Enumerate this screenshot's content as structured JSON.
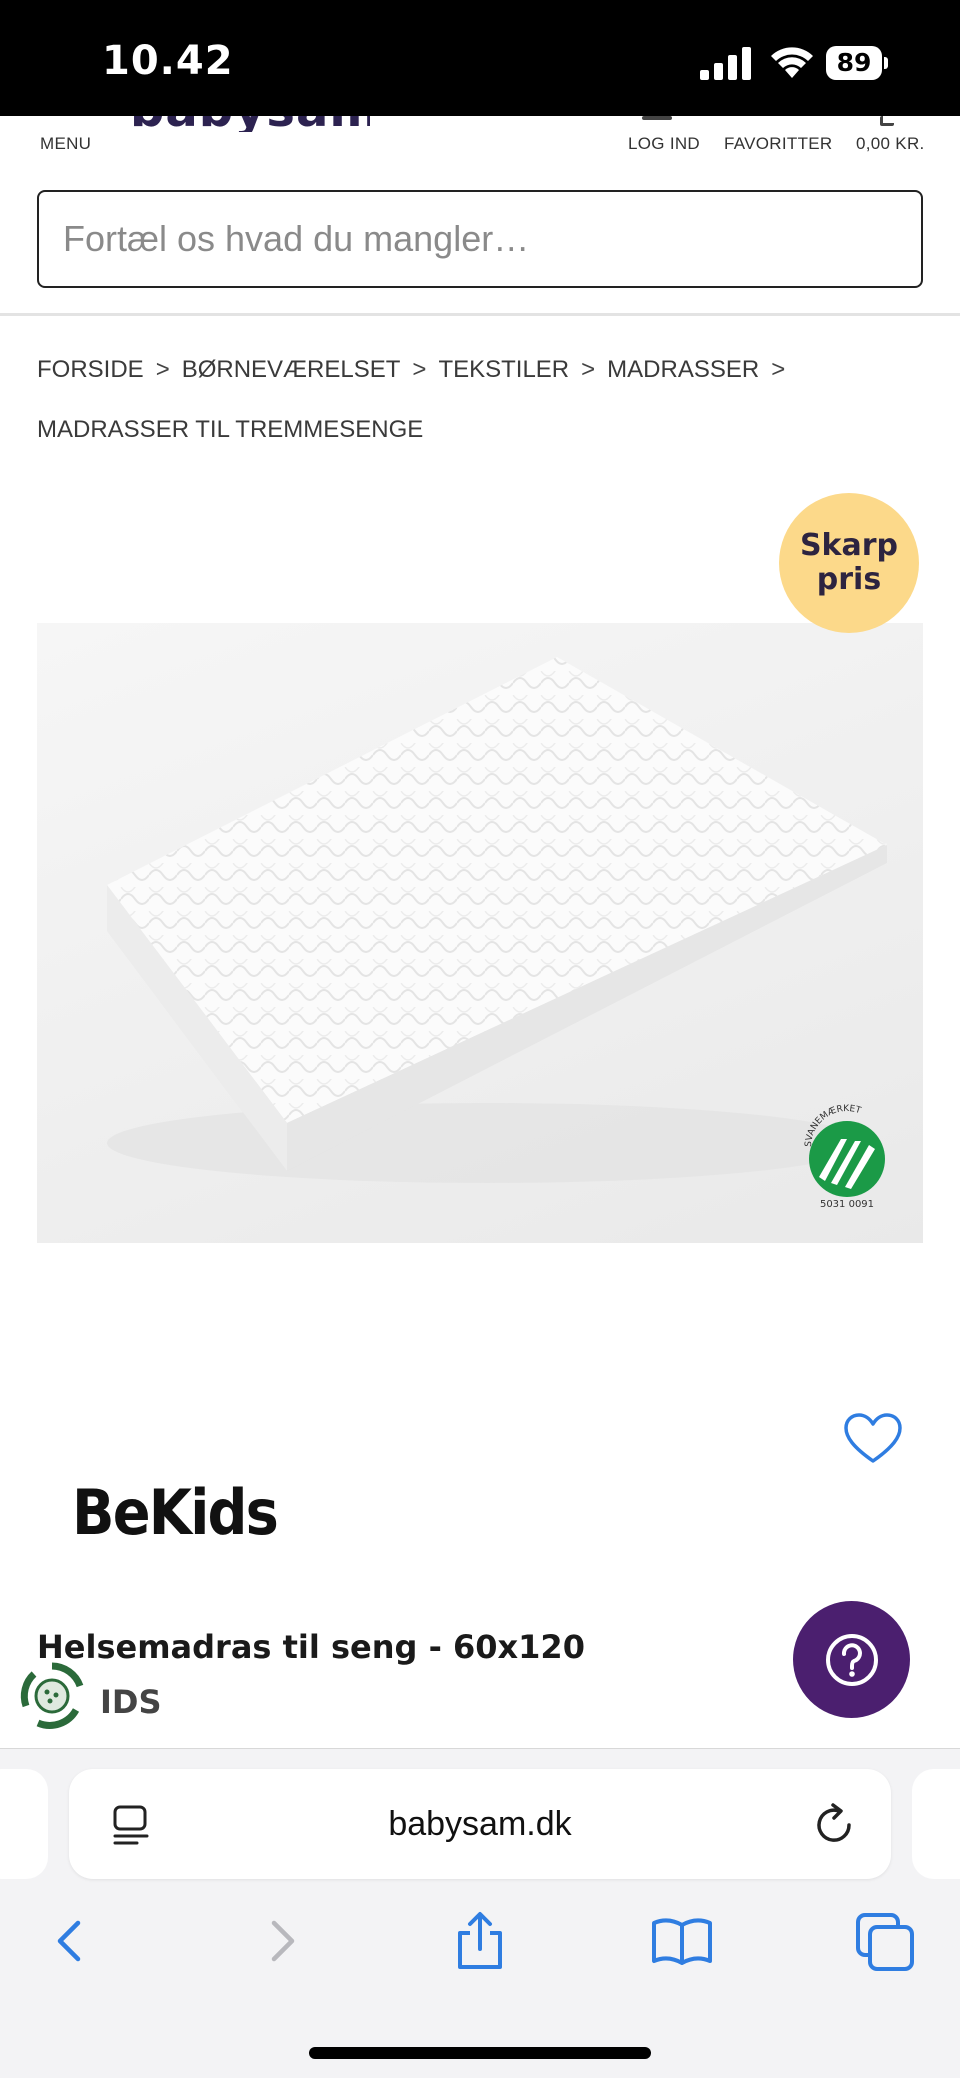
{
  "status_bar": {
    "time": "10.42",
    "battery": "89"
  },
  "site": {
    "logo_partial": "babysam"
  },
  "header": {
    "menu_label": "MENU",
    "login_label": "LOG IND",
    "favorites_label": "FAVORITTER",
    "cart_total": "0,00 KR."
  },
  "search": {
    "placeholder": "Fortæl os hvad du mangler…"
  },
  "breadcrumb": {
    "items": [
      "FORSIDE",
      "BØRNEVÆRELSET",
      "TEKSTILER",
      "MADRASSER",
      "MADRASSER TIL TREMMESENGE"
    ],
    "separator": ">"
  },
  "badge": {
    "line1": "Skarp",
    "line2": "pris",
    "color": "#fcd98a"
  },
  "product_image": {
    "certification_arc": "SVANEMÆRKET",
    "certification_number": "5031 0091"
  },
  "product": {
    "brand": "BeKids",
    "title": "Helsemadras til seng - 60x120"
  },
  "cookie_widget": {
    "text": "IDS"
  },
  "help": {
    "icon": "question-icon",
    "color": "#4b1f6f"
  },
  "browser": {
    "url": "babysam.dk",
    "accent_color": "#2f7de1"
  }
}
